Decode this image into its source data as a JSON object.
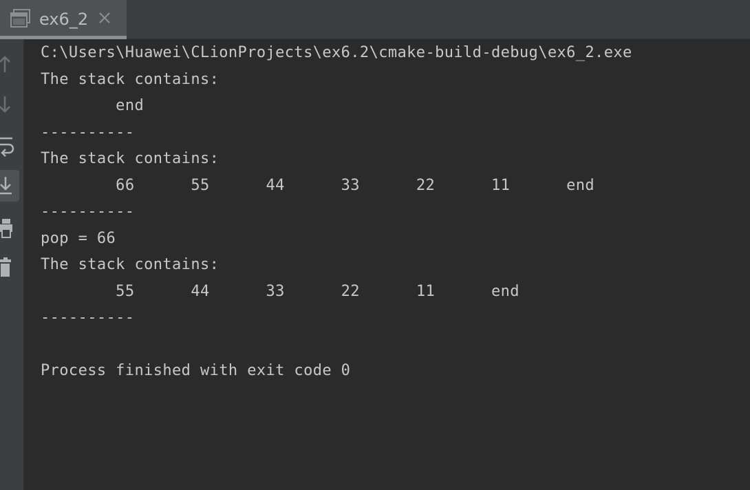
{
  "tab": {
    "title": "ex6_2"
  },
  "icons": {
    "tab_icon": "console-window-icon",
    "tab_close": "close-icon",
    "tool_up": "arrow-up-icon",
    "tool_down": "arrow-down-icon",
    "tool_wrap": "soft-wrap-icon",
    "tool_scroll": "scroll-to-end-icon",
    "tool_print": "print-icon",
    "tool_clear": "trash-icon"
  },
  "colors": {
    "background": "#2b2b2b",
    "panel": "#3c3f41",
    "text": "#c8c8c8"
  },
  "console": {
    "lines": [
      "C:\\Users\\Huawei\\CLionProjects\\ex6.2\\cmake-build-debug\\ex6_2.exe",
      "The stack contains:",
      "\tend",
      "----------",
      "The stack contains:",
      "\t66\t55\t44\t33\t22\t11\tend",
      "----------",
      "pop = 66",
      "The stack contains:",
      "\t55\t44\t33\t22\t11\tend",
      "----------",
      "",
      "Process finished with exit code 0"
    ]
  }
}
